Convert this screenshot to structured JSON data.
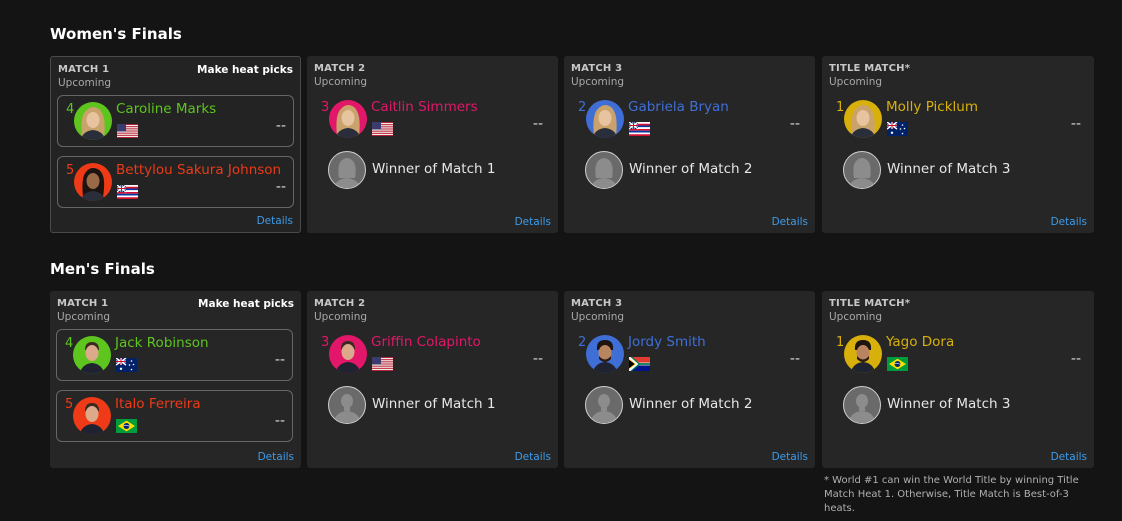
{
  "women": {
    "title": "Women's Finals",
    "matches": [
      {
        "name": "MATCH 1",
        "status": "Upcoming",
        "heat_picks": "Make heat picks",
        "details": "Details",
        "athletes": [
          {
            "seed": "4",
            "name": "Caroline Marks",
            "flag": "usa-flag-icon",
            "score": "--",
            "color": "#5ec51e"
          },
          {
            "seed": "5",
            "name": "Bettylou Sakura Johnson",
            "flag": "hawaii-flag-icon",
            "score": "--",
            "color": "#ee3a16"
          }
        ]
      },
      {
        "name": "MATCH 2",
        "status": "Upcoming",
        "details": "Details",
        "athlete": {
          "seed": "3",
          "name": "Caitlin Simmers",
          "flag": "usa-flag-icon",
          "score": "--",
          "color": "#e2176a"
        },
        "opponent": "Winner of Match 1"
      },
      {
        "name": "MATCH 3",
        "status": "Upcoming",
        "details": "Details",
        "athlete": {
          "seed": "2",
          "name": "Gabriela Bryan",
          "flag": "hawaii-flag-icon",
          "score": "--",
          "color": "#3f6fd6"
        },
        "opponent": "Winner of Match 2"
      },
      {
        "name": "TITLE MATCH*",
        "status": "Upcoming",
        "details": "Details",
        "athlete": {
          "seed": "1",
          "name": "Molly Picklum",
          "flag": "australia-flag-icon",
          "score": "--",
          "color": "#d8b00c"
        },
        "opponent": "Winner of Match 3"
      }
    ]
  },
  "men": {
    "title": "Men's Finals",
    "matches": [
      {
        "name": "MATCH 1",
        "status": "Upcoming",
        "heat_picks": "Make heat picks",
        "details": "Details",
        "athletes": [
          {
            "seed": "4",
            "name": "Jack Robinson",
            "flag": "australia-flag-icon",
            "score": "--",
            "color": "#5ec51e"
          },
          {
            "seed": "5",
            "name": "Italo Ferreira",
            "flag": "brazil-flag-icon",
            "score": "--",
            "color": "#ee3a16"
          }
        ]
      },
      {
        "name": "MATCH 2",
        "status": "Upcoming",
        "details": "Details",
        "athlete": {
          "seed": "3",
          "name": "Griffin Colapinto",
          "flag": "usa-flag-icon",
          "score": "--",
          "color": "#e2176a"
        },
        "opponent": "Winner of Match 1"
      },
      {
        "name": "MATCH 3",
        "status": "Upcoming",
        "details": "Details",
        "athlete": {
          "seed": "2",
          "name": "Jordy Smith",
          "flag": "south-africa-flag-icon",
          "score": "--",
          "color": "#3f6fd6"
        },
        "opponent": "Winner of Match 2"
      },
      {
        "name": "TITLE MATCH*",
        "status": "Upcoming",
        "details": "Details",
        "athlete": {
          "seed": "1",
          "name": "Yago Dora",
          "flag": "brazil-flag-icon",
          "score": "--",
          "color": "#d8b00c"
        },
        "opponent": "Winner of Match 3"
      }
    ]
  },
  "footnote": "* World #1 can win the World Title by winning Title Match Heat 1. Otherwise, Title Match is Best-of-3 heats."
}
